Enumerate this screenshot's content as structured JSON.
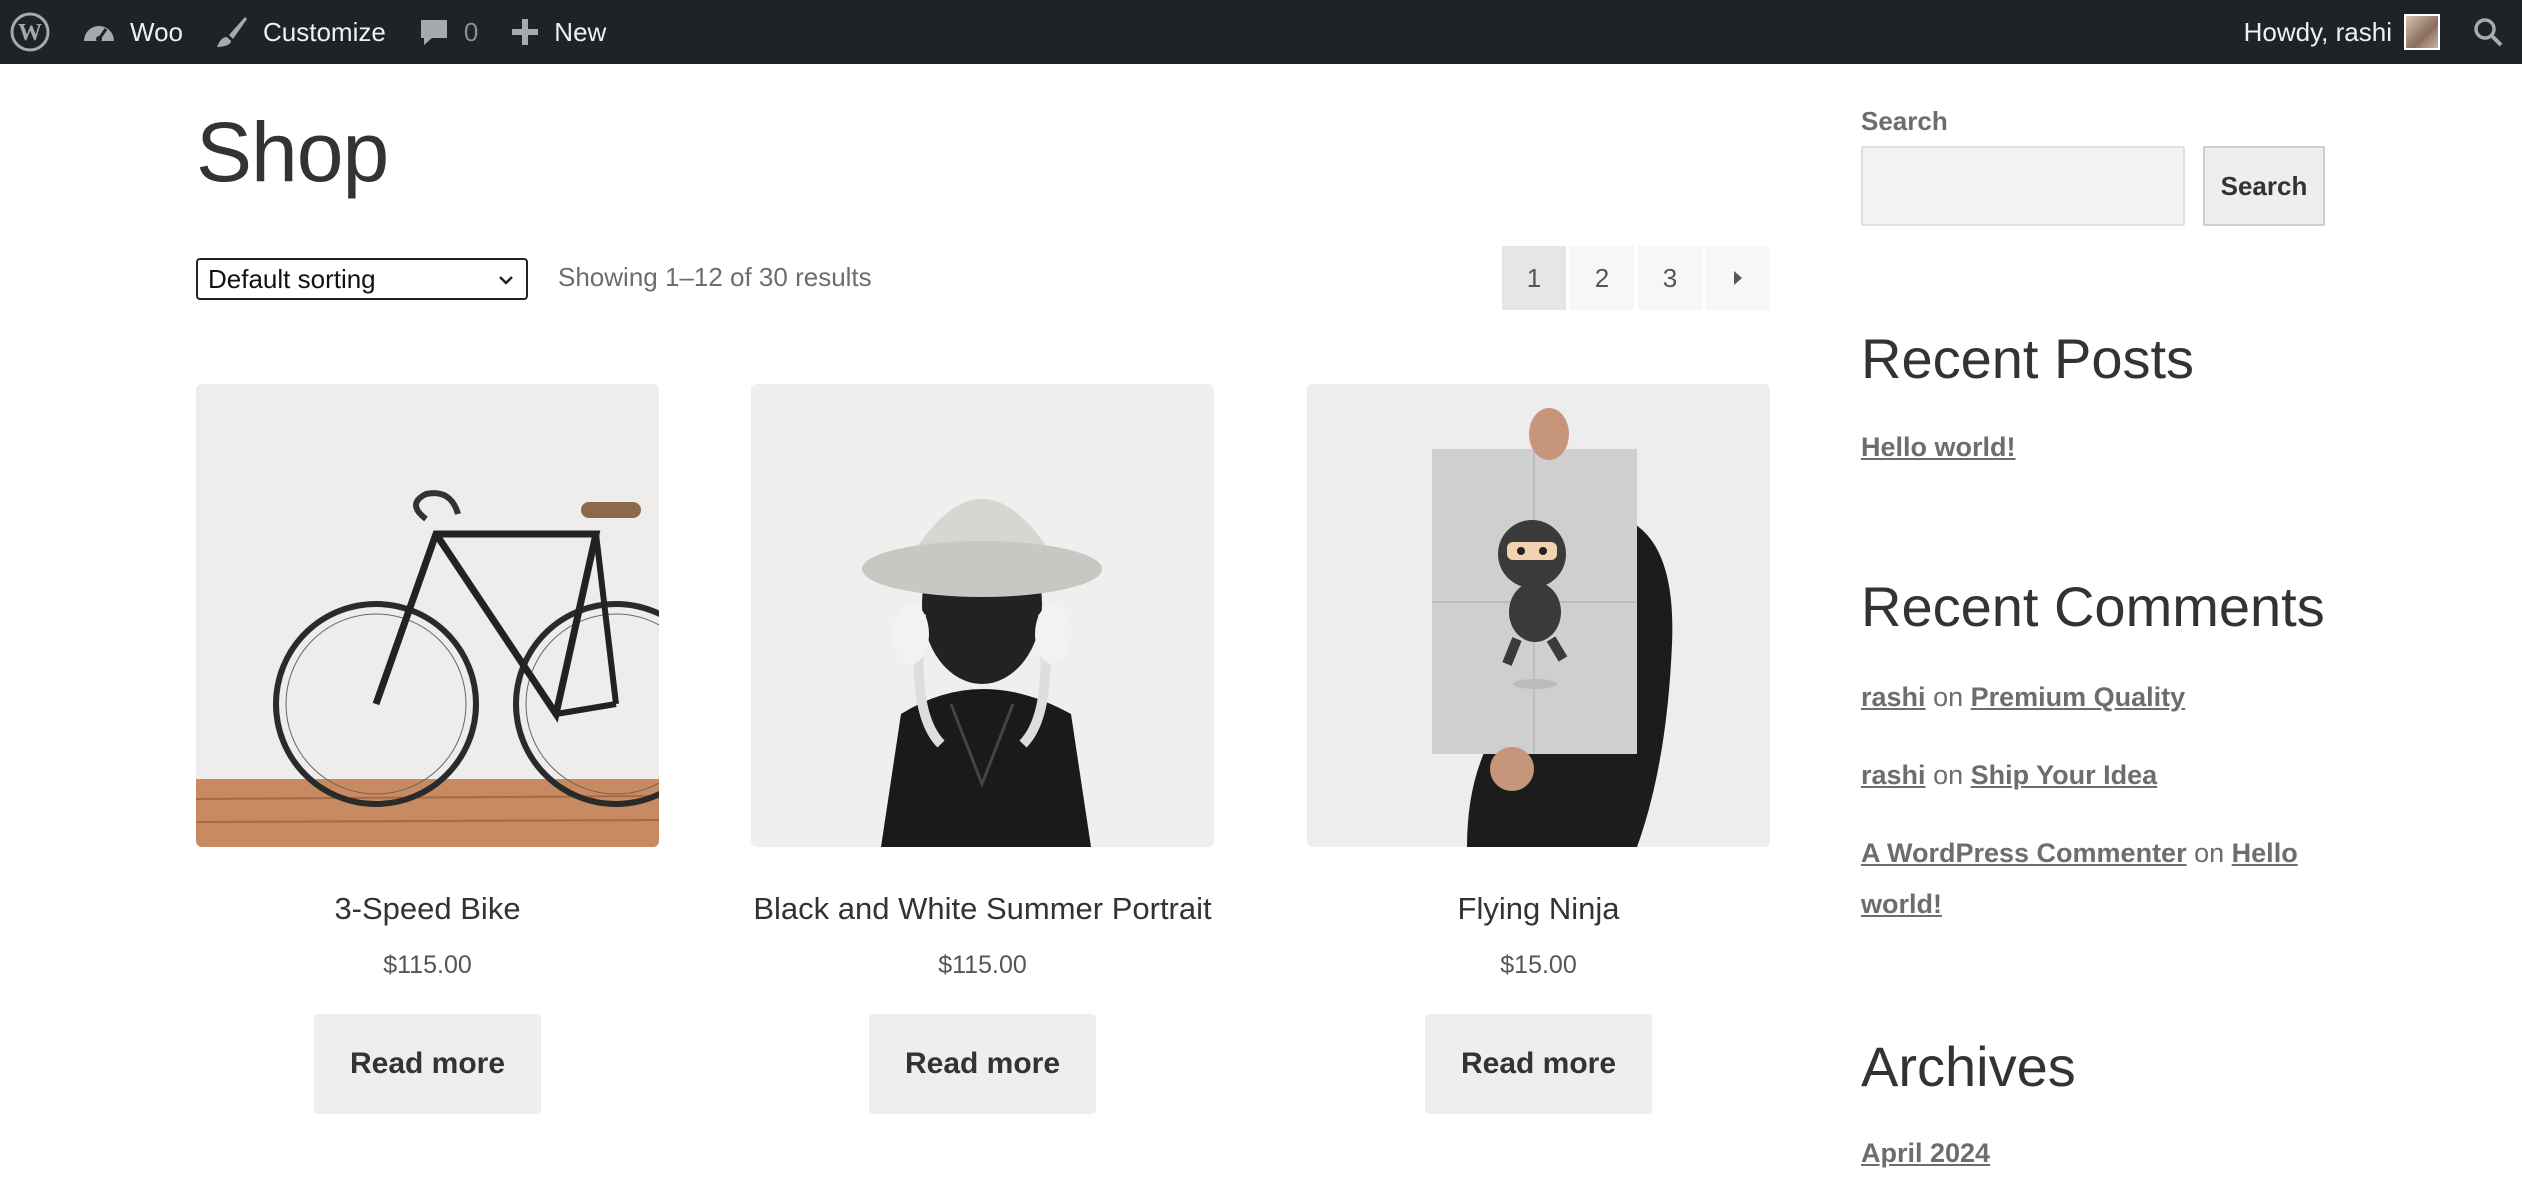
{
  "adminbar": {
    "site_name": "Woo",
    "customize_label": "Customize",
    "comments_count": "0",
    "new_label": "New",
    "howdy_text": "Howdy, rashi"
  },
  "shop": {
    "title": "Shop",
    "sort_selected": "Default sorting",
    "result_count": "Showing 1–12 of 30 results",
    "pages": [
      "1",
      "2",
      "3"
    ],
    "current_page": "1"
  },
  "products": [
    {
      "name": "3-Speed Bike",
      "price": "$115.00",
      "button": "Read more",
      "image": "bicycle"
    },
    {
      "name": "Black and White Summer Portrait",
      "price": "$115.00",
      "button": "Read more",
      "image": "portrait-woman-hat"
    },
    {
      "name": "Flying Ninja",
      "price": "$15.00",
      "button": "Read more",
      "image": "ninja-poster"
    }
  ],
  "sidebar": {
    "search_label": "Search",
    "search_button": "Search",
    "recent_posts_heading": "Recent Posts",
    "recent_posts": [
      "Hello world!"
    ],
    "recent_comments_heading": "Recent Comments",
    "recent_comments": [
      {
        "author": "rashi",
        "on": "on",
        "post": "Premium Quality"
      },
      {
        "author": "rashi",
        "on": "on",
        "post": "Ship Your Idea"
      },
      {
        "author": "A WordPress Commenter",
        "on": "on",
        "post_line1": "Hello",
        "post_line2": "world!"
      }
    ],
    "archives_heading": "Archives",
    "archives": [
      "April 2024"
    ]
  },
  "colors": {
    "adminbar_bg": "#1d2327",
    "page_bg": "#ffffff",
    "button_bg": "#eeeeee",
    "text": "#333333",
    "muted": "#6d6d6d"
  }
}
